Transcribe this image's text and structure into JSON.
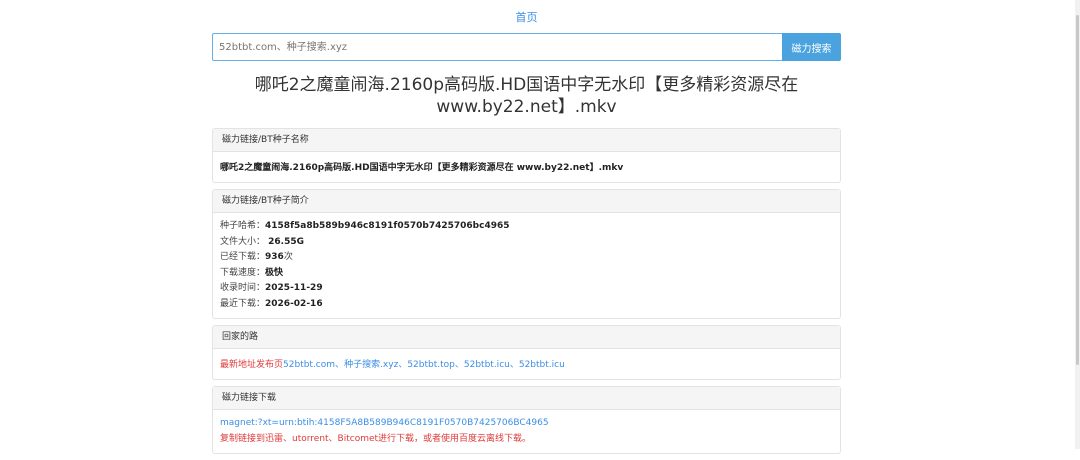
{
  "nav": {
    "home": "首页"
  },
  "search": {
    "placeholder": "52btbt.com、种子搜索.xyz",
    "button": "磁力搜索"
  },
  "title": "哪吒2之魔童闹海.2160p高码版.HD国语中字无水印【更多精彩资源尽在www.by22.net】.mkv",
  "name_panel": {
    "heading": "磁力链接/BT种子名称",
    "value": "哪吒2之魔童闹海.2160p高码版.HD国语中字无水印【更多精彩资源尽在 www.by22.net】.mkv"
  },
  "info_panel": {
    "heading": "磁力链接/BT种子简介",
    "rows": [
      {
        "label": "种子哈希：",
        "value": "4158f5a8b589b946c8191f0570b7425706bc4965",
        "suffix": ""
      },
      {
        "label": "文件大小：",
        "value": " 26.55G",
        "suffix": ""
      },
      {
        "label": "已经下载：",
        "value": "936",
        "suffix": "次"
      },
      {
        "label": "下载速度：",
        "value": "极快",
        "suffix": ""
      },
      {
        "label": "收录时间：",
        "value": "2025-11-29",
        "suffix": ""
      },
      {
        "label": "最近下载：",
        "value": "2026-02-16",
        "suffix": ""
      }
    ]
  },
  "home_panel": {
    "heading": "回家的路",
    "prefix": "最新地址发布页",
    "links": [
      "52btbt.com",
      "种子搜索.xyz",
      "52btbt.top",
      "52btbt.icu",
      "52btbt.icu"
    ],
    "separator": "、"
  },
  "download_panel": {
    "heading": "磁力链接下载",
    "magnet": "magnet:?xt=urn:btih:4158F5A8B589B946C8191F0570B7425706BC4965",
    "note": "复制链接到迅雷、utorrent、Bitcomet进行下载，或者使用百度云离线下载。"
  },
  "colors": {
    "accent": "#4aa3df",
    "link": "#3a8ee6",
    "warning": "#e03a3a"
  }
}
